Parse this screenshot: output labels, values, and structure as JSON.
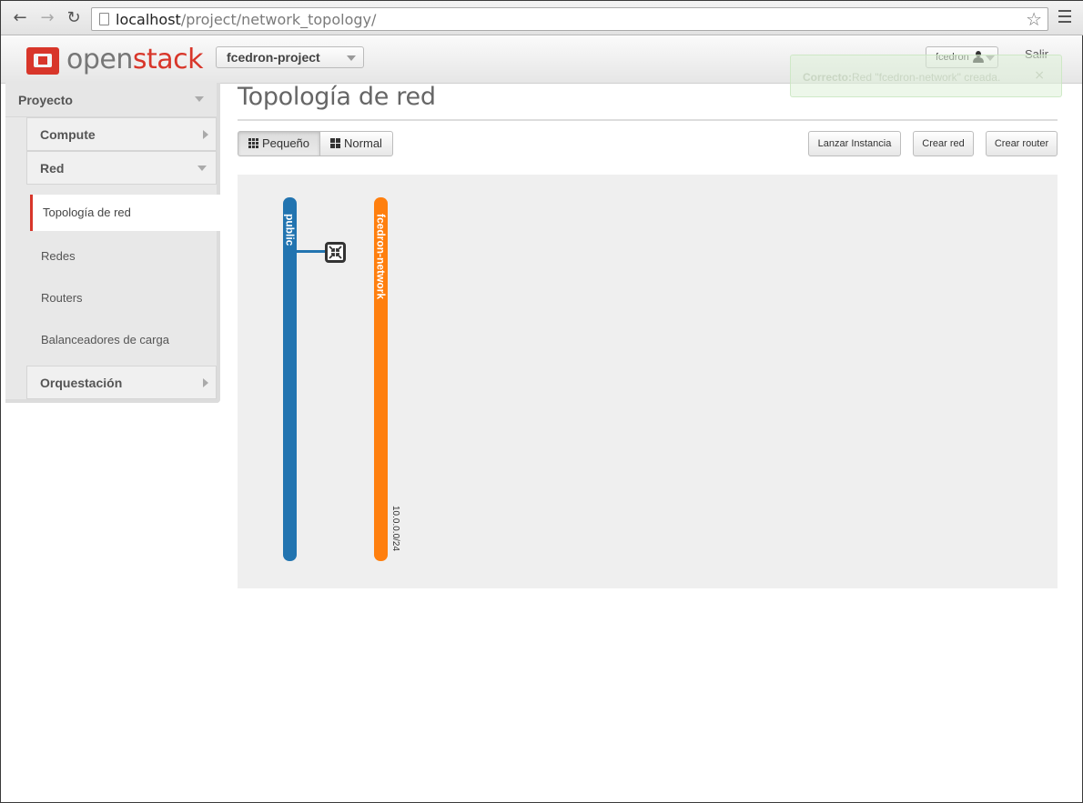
{
  "browser": {
    "url_host": "localhost",
    "url_path": "/project/network_topology/"
  },
  "header": {
    "logo_text_light": "open",
    "logo_text_bold": "stack",
    "project_selector": "fcedron-project",
    "user_menu": "fcedron",
    "logout": "Salir"
  },
  "alert": {
    "prefix": "Correcto:",
    "message": "Red \"fcedron-network\" creada."
  },
  "sidebar": {
    "dashboard": "Proyecto",
    "panels": [
      {
        "label": "Compute"
      },
      {
        "label": "Red"
      },
      {
        "label": "Orquestación"
      }
    ],
    "items": [
      {
        "label": "Topología de red"
      },
      {
        "label": "Redes"
      },
      {
        "label": "Routers"
      },
      {
        "label": "Balanceadores de carga"
      }
    ]
  },
  "main": {
    "title": "Topología de red",
    "view_small": "Pequeño",
    "view_normal": "Normal",
    "launch_instance": "Lanzar Instancia",
    "create_network": "Crear red",
    "create_router": "Crear router"
  },
  "topology": {
    "networks": [
      {
        "name": "public",
        "color": "#2274b0"
      },
      {
        "name": "fcedron-network",
        "color": "#ff7f0e",
        "subnet": "10.0.0.0/24"
      }
    ]
  }
}
